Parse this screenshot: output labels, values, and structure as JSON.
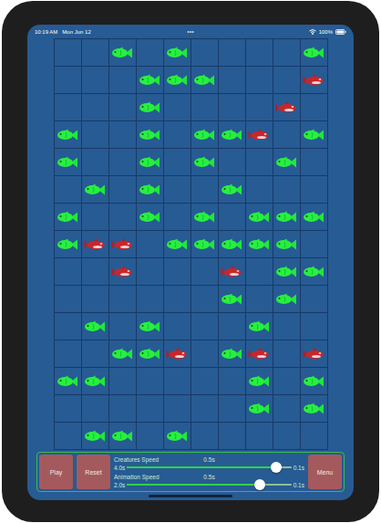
{
  "status_bar": {
    "time": "10:19 AM",
    "date": "Mon Jun 12",
    "dots": "•••",
    "battery": "100%"
  },
  "grid": {
    "rows": [
      [
        "empty",
        "empty",
        "fish",
        "empty",
        "fish",
        "empty",
        "empty",
        "empty",
        "empty",
        "fish"
      ],
      [
        "empty",
        "empty",
        "empty",
        "fish",
        "fish",
        "fish",
        "empty",
        "empty",
        "empty",
        "orca"
      ],
      [
        "empty",
        "empty",
        "empty",
        "fish",
        "empty",
        "empty",
        "empty",
        "empty",
        "orca",
        "empty"
      ],
      [
        "fish",
        "empty",
        "empty",
        "fish",
        "empty",
        "fish",
        "fish",
        "orca",
        "empty",
        "fish"
      ],
      [
        "fish",
        "empty",
        "empty",
        "fish",
        "empty",
        "fish",
        "empty",
        "empty",
        "fish",
        "empty"
      ],
      [
        "empty",
        "fish",
        "empty",
        "fish",
        "empty",
        "empty",
        "fish",
        "empty",
        "empty",
        "empty"
      ],
      [
        "fish",
        "empty",
        "empty",
        "fish",
        "empty",
        "fish",
        "empty",
        "fish",
        "fish",
        "fish"
      ],
      [
        "fish",
        "orca",
        "orca",
        "empty",
        "fish",
        "fish",
        "fish",
        "fish",
        "fish",
        "empty"
      ],
      [
        "empty",
        "empty",
        "orca",
        "empty",
        "empty",
        "empty",
        "orca",
        "empty",
        "fish",
        "fish"
      ],
      [
        "empty",
        "empty",
        "empty",
        "empty",
        "empty",
        "empty",
        "fish",
        "empty",
        "fish",
        "empty"
      ],
      [
        "empty",
        "fish",
        "empty",
        "fish",
        "empty",
        "empty",
        "empty",
        "fish",
        "empty",
        "empty"
      ],
      [
        "empty",
        "empty",
        "fish",
        "fish",
        "orca",
        "empty",
        "fish",
        "orca",
        "empty",
        "orca"
      ],
      [
        "fish",
        "fish",
        "empty",
        "empty",
        "empty",
        "empty",
        "empty",
        "fish",
        "empty",
        "fish"
      ],
      [
        "empty",
        "empty",
        "empty",
        "empty",
        "empty",
        "empty",
        "empty",
        "fish",
        "empty",
        "fish"
      ],
      [
        "empty",
        "fish",
        "fish",
        "empty",
        "fish",
        "empty",
        "empty",
        "empty",
        "empty",
        "empty"
      ]
    ]
  },
  "controls": {
    "left_buttons": [
      {
        "label": "Play"
      },
      {
        "label": "Reset"
      }
    ],
    "sliders": [
      {
        "name": "Creatures Speed",
        "reading": "0.5s",
        "min_label": "4.0s",
        "max_label": "0.1s",
        "level": 0.91
      },
      {
        "name": "Animation Speed",
        "reading": "0.5s",
        "min_label": "2.0s",
        "max_label": "0.1s",
        "level": 0.81
      }
    ],
    "menu_button": {
      "label": "Menu"
    }
  }
}
